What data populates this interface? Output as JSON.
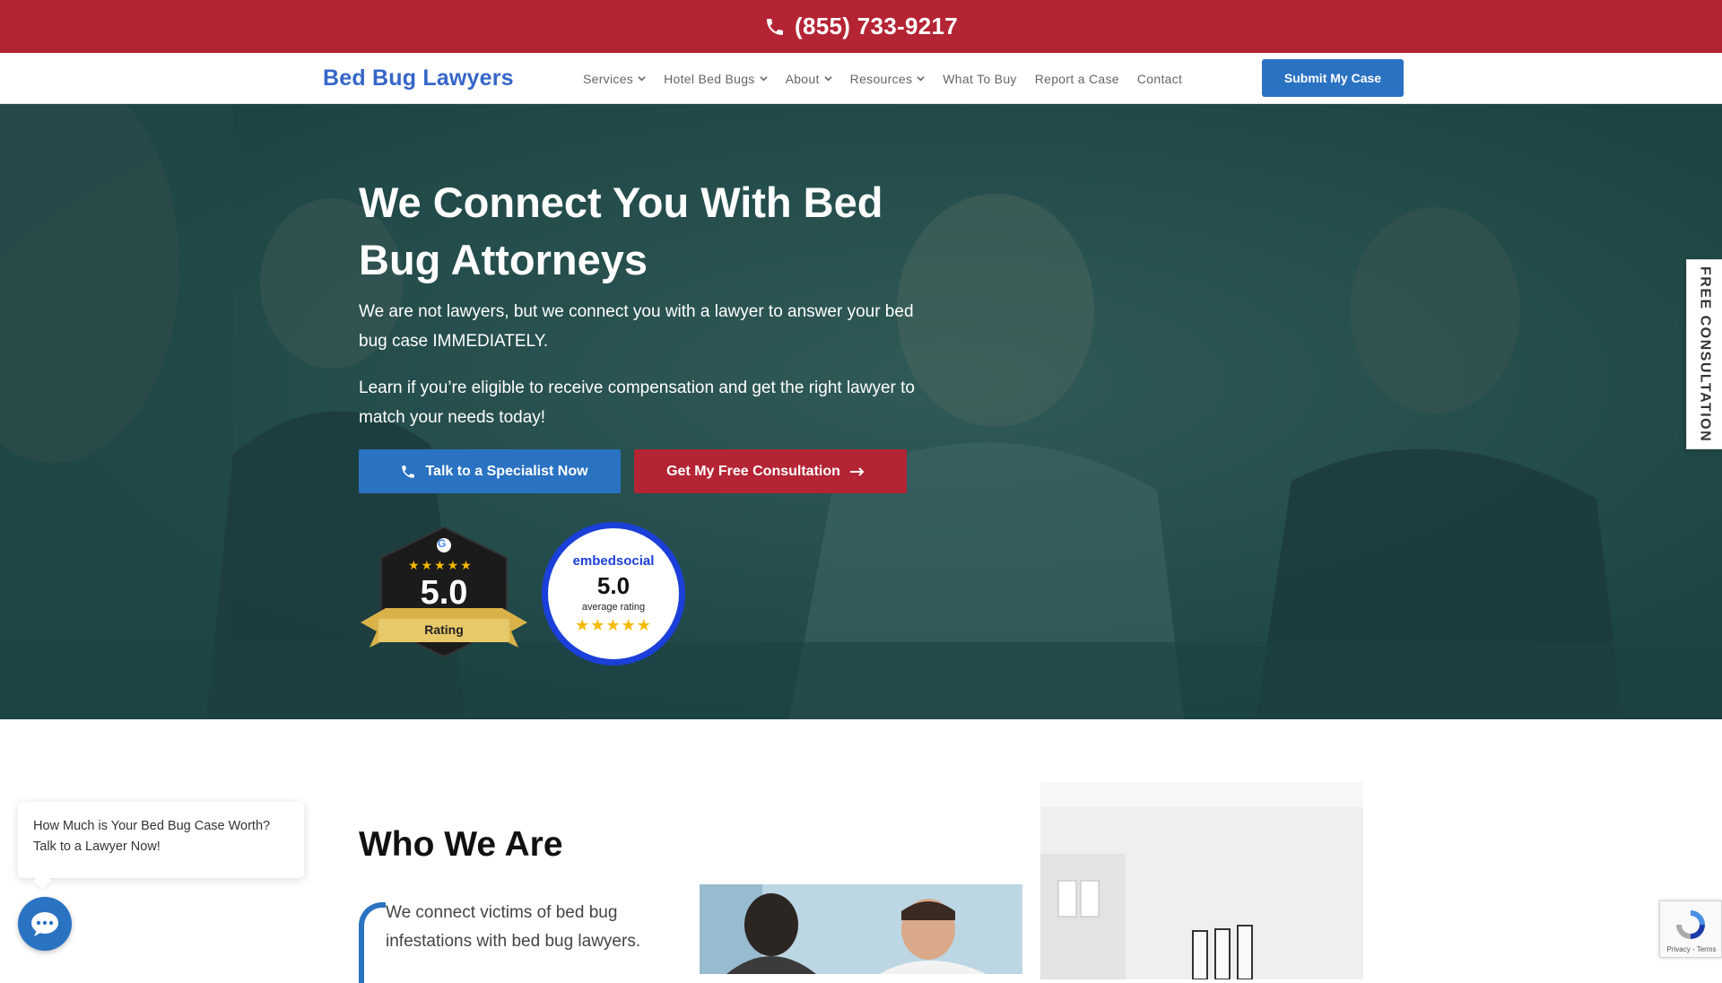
{
  "topbar": {
    "phone": "(855) 733-9217"
  },
  "nav": {
    "logo": "Bed Bug Lawyers",
    "items": [
      {
        "label": "Services",
        "has_dropdown": true
      },
      {
        "label": "Hotel Bed Bugs",
        "has_dropdown": true
      },
      {
        "label": "About",
        "has_dropdown": true
      },
      {
        "label": "Resources",
        "has_dropdown": true
      },
      {
        "label": "What To Buy",
        "has_dropdown": false
      },
      {
        "label": "Report a Case",
        "has_dropdown": false
      },
      {
        "label": "Contact",
        "has_dropdown": false
      }
    ],
    "cta": "Submit My Case"
  },
  "hero": {
    "title": "We Connect You With Bed Bug Attorneys",
    "paragraph1": "We are not lawyers, but we connect you with a lawyer to answer your bed bug case IMMEDIATELY.",
    "paragraph2": "Learn if you’re eligible to receive compensation and get the right lawyer to match your needs today!",
    "btn_primary": "Talk to a Specialist Now",
    "btn_secondary": "Get My Free Consultation"
  },
  "badges": {
    "google": {
      "score": "5.0",
      "label": "Rating",
      "stars": "★★★★★",
      "g": "G"
    },
    "embedsocial": {
      "logo": "embedsocial",
      "score": "5.0",
      "label": "average rating",
      "stars": "★★★★★"
    }
  },
  "sidetab": "FREE CONSULTATION",
  "who": {
    "title": "Who We Are",
    "text": "We connect victims of bed bug infestations with bed bug lawyers."
  },
  "chat": {
    "message": "How Much is Your Bed Bug Case Worth? Talk to a Lawyer Now!"
  },
  "recaptcha": {
    "text": "Privacy - Terms"
  },
  "colors": {
    "brand_red": "#b42434",
    "brand_blue": "#2a72c2",
    "logo_blue": "#3566c9",
    "hero_overlay": "#1b4848"
  }
}
